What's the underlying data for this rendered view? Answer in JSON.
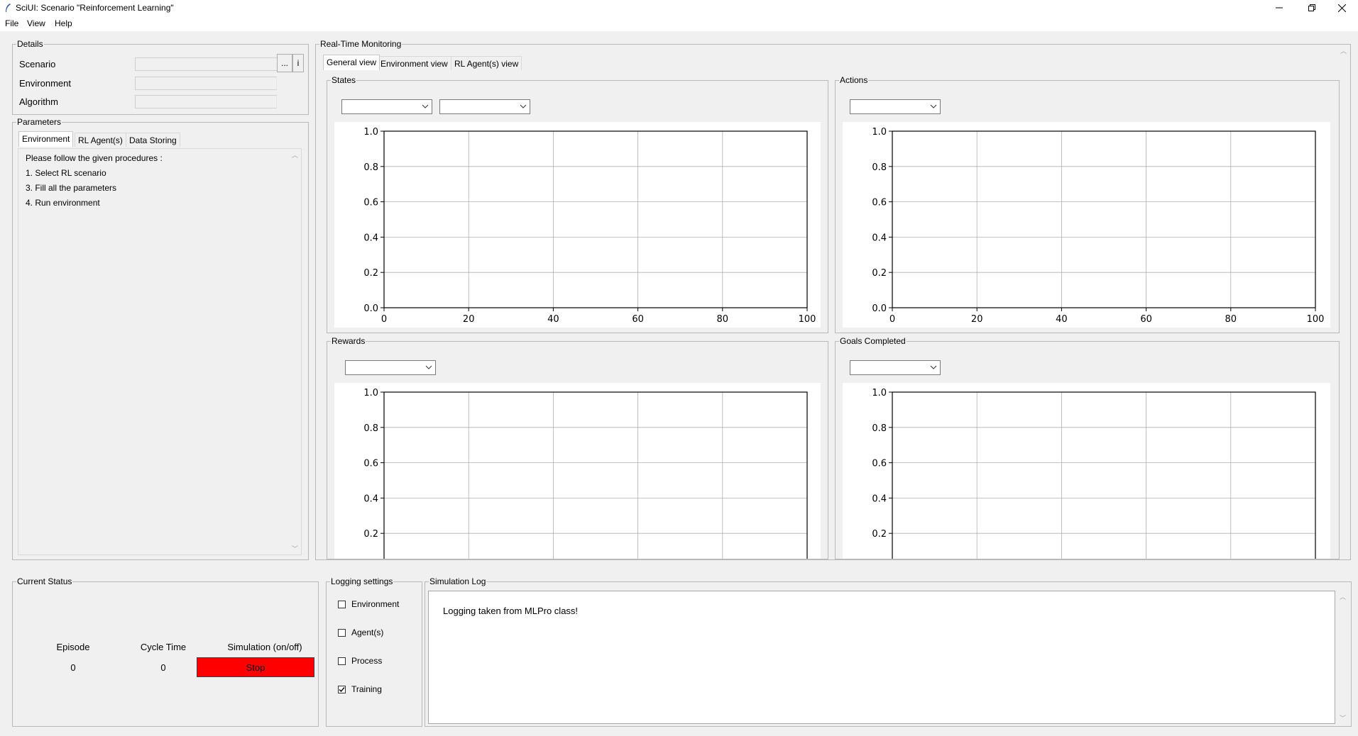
{
  "window": {
    "title": "SciUI: Scenario \"Reinforcement Learning\"",
    "minimize": "—",
    "restore": "❐",
    "close": "✕"
  },
  "menu": [
    "File",
    "View",
    "Help"
  ],
  "details": {
    "title": "Details",
    "scenario_label": "Scenario",
    "environment_label": "Environment",
    "algorithm_label": "Algorithm",
    "scenario_value": "",
    "environment_value": "",
    "algorithm_value": "",
    "browse_button": "...",
    "info_button": "i"
  },
  "parameters": {
    "title": "Parameters",
    "tabs": [
      "Environment",
      "RL Agent(s)",
      "Data Storing"
    ],
    "active_tab": "Environment",
    "lines": [
      "Please follow the given procedures :",
      "1. Select RL scenario",
      "3. Fill all the parameters",
      "4. Run environment"
    ]
  },
  "monitoring": {
    "title": "Real-Time Monitoring",
    "tabs": [
      "General view",
      "Environment view",
      "RL Agent(s) view"
    ],
    "active_tab": "General view",
    "panels": {
      "states": "States",
      "actions": "Actions",
      "rewards": "Rewards",
      "goals": "Goals Completed"
    }
  },
  "chart_data": [
    {
      "type": "line",
      "title": "",
      "panel": "States",
      "series": [],
      "xlim": [
        0,
        100
      ],
      "ylim": [
        0,
        1
      ],
      "xticks": [
        "0",
        "20",
        "40",
        "60",
        "80",
        "100"
      ],
      "yticks": [
        "0.0",
        "0.2",
        "0.4",
        "0.6",
        "0.8",
        "1.0"
      ],
      "grid": true
    },
    {
      "type": "line",
      "title": "",
      "panel": "Actions",
      "series": [],
      "xlim": [
        0,
        100
      ],
      "ylim": [
        0,
        1
      ],
      "xticks": [
        "0",
        "20",
        "40",
        "60",
        "80",
        "100"
      ],
      "yticks": [
        "0.0",
        "0.2",
        "0.4",
        "0.6",
        "0.8",
        "1.0"
      ],
      "grid": true
    },
    {
      "type": "line",
      "title": "",
      "panel": "Rewards",
      "series": [],
      "xlim": [
        0,
        100
      ],
      "ylim": [
        0,
        1
      ],
      "xticks": [],
      "yticks": [
        "0.2",
        "0.4",
        "0.6",
        "0.8",
        "1.0"
      ],
      "grid": true
    },
    {
      "type": "line",
      "title": "",
      "panel": "Goals Completed",
      "series": [],
      "xlim": [
        0,
        100
      ],
      "ylim": [
        0,
        1
      ],
      "xticks": [],
      "yticks": [
        "0.2",
        "0.4",
        "0.6",
        "0.8",
        "1.0"
      ],
      "grid": true
    }
  ],
  "status": {
    "title": "Current Status",
    "episode_label": "Episode",
    "cycle_label": "Cycle Time",
    "sim_label": "Simulation (on/off)",
    "episode_value": "0",
    "cycle_value": "0",
    "stop_button": "Stop",
    "stop_color": "#ff0000"
  },
  "logging": {
    "title": "Logging settings",
    "options": [
      {
        "label": "Environment",
        "checked": false
      },
      {
        "label": "Agent(s)",
        "checked": false
      },
      {
        "label": "Process",
        "checked": false
      },
      {
        "label": "Training",
        "checked": true
      }
    ]
  },
  "simlog": {
    "title": "Simulation Log",
    "text": "Logging taken from MLPro class!"
  }
}
